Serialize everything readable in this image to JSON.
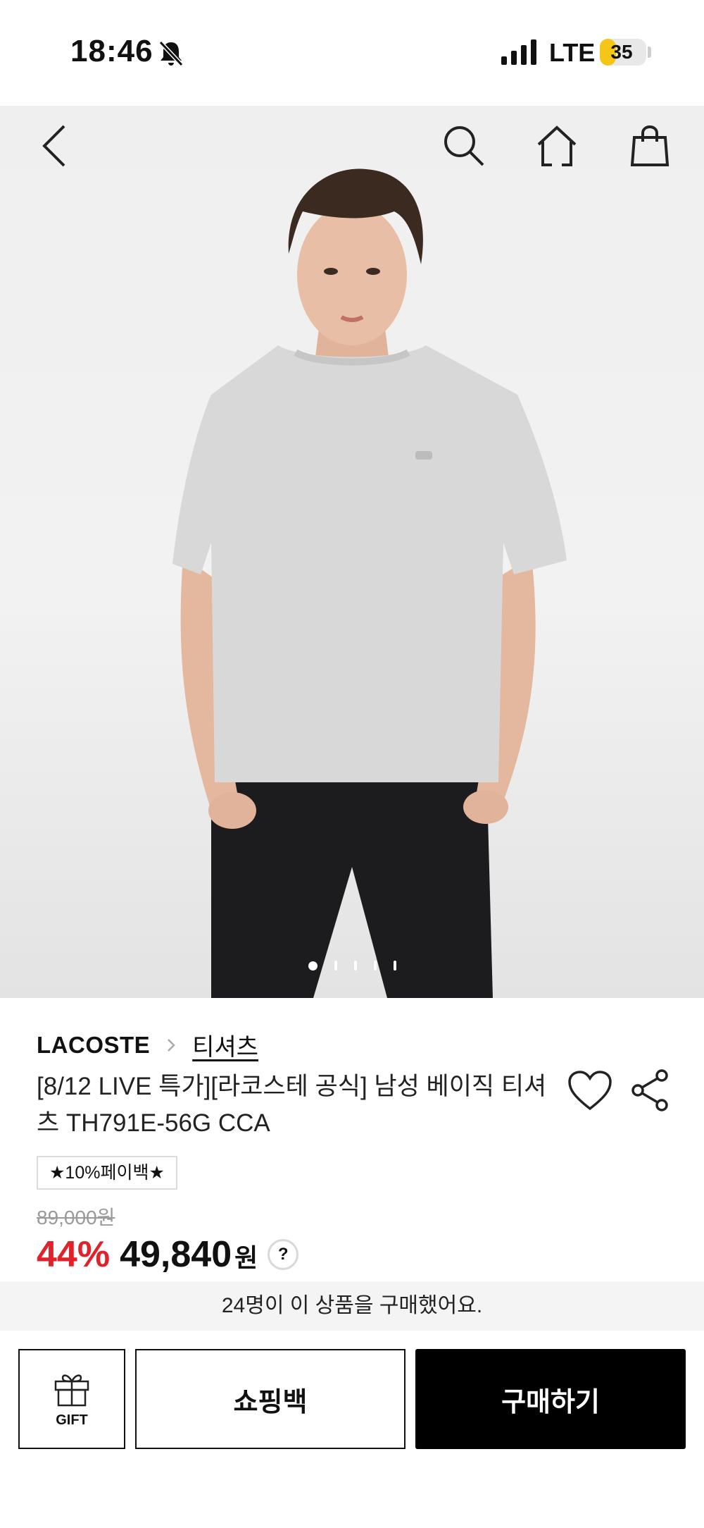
{
  "status_bar": {
    "time": "18:46",
    "network": "LTE",
    "battery": "35",
    "battery_level": 0.35,
    "icons": [
      "bell-off-icon",
      "signal-icon",
      "battery-icon"
    ]
  },
  "nav": {
    "icons": [
      "back-icon",
      "search-icon",
      "home-icon",
      "shopping-bag-icon"
    ]
  },
  "gallery": {
    "image_count": 5,
    "active_index": 0
  },
  "product": {
    "brand": "LACOSTE",
    "category": "티셔츠",
    "title": "[8/12 LIVE 특가][라코스테 공식] 남성 베이직 티셔츠 TH791E-56G CCA",
    "badge": "★10%페이백★",
    "original_price": "89,000원",
    "discount": "44%",
    "price": "49,840",
    "currency": "원",
    "help": "?",
    "accent_color": "#e1222b"
  },
  "notice": "24명이 이 상품을 구매했어요.",
  "actions": {
    "gift_label": "GIFT",
    "cart_label": "쇼핑백",
    "buy_label": "구매하기"
  }
}
